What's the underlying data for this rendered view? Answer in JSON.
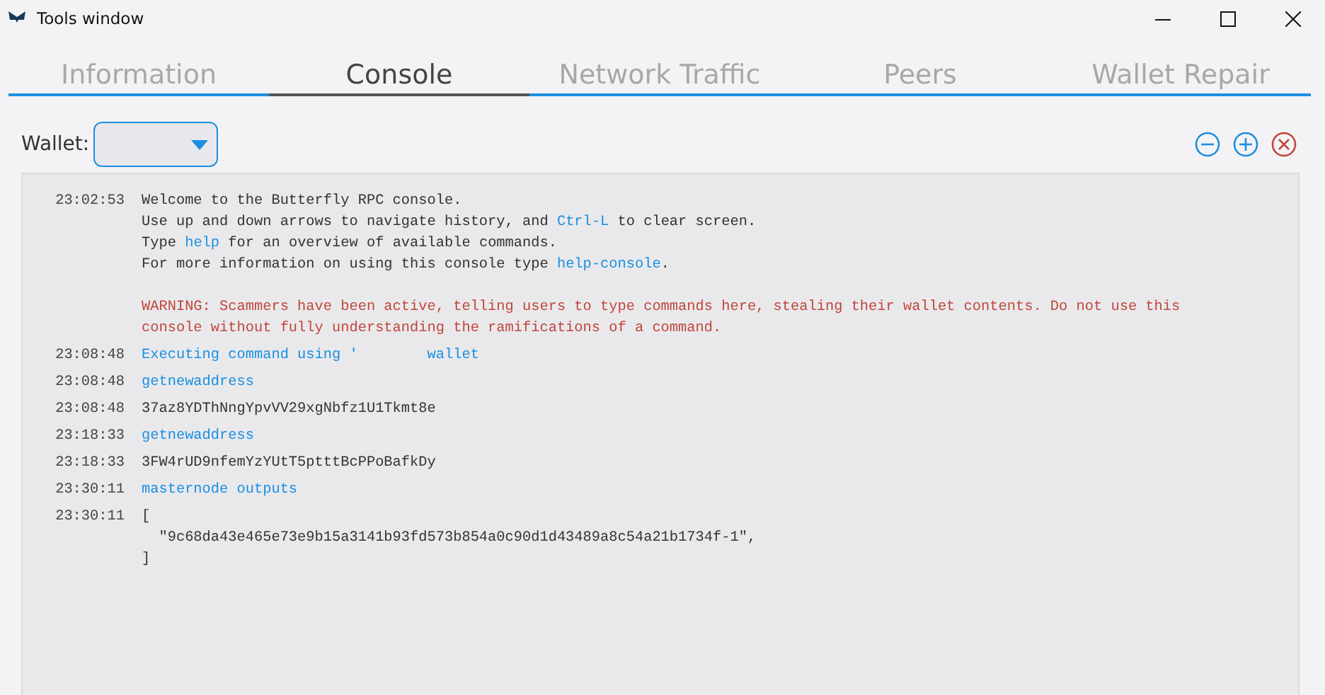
{
  "window": {
    "title": "Tools window"
  },
  "tabs": [
    {
      "label": "Information",
      "selected": false
    },
    {
      "label": "Console",
      "selected": true
    },
    {
      "label": "Network Traffic",
      "selected": false
    },
    {
      "label": "Peers",
      "selected": false
    },
    {
      "label": "Wallet Repair",
      "selected": false
    }
  ],
  "wallet": {
    "label": "Wallet:"
  },
  "console": [
    {
      "time": "23:02:53",
      "kind": "welcome",
      "lines": [
        [
          {
            "text": "Welcome to the Butterfly RPC console.",
            "kind": "plain"
          }
        ],
        [
          {
            "text": "Use up and down arrows to navigate history, and ",
            "kind": "plain"
          },
          {
            "text": "Ctrl-L",
            "kind": "command"
          },
          {
            "text": " to clear screen.",
            "kind": "plain"
          }
        ],
        [
          {
            "text": "Type ",
            "kind": "plain"
          },
          {
            "text": "help",
            "kind": "command"
          },
          {
            "text": " for an overview of available commands.",
            "kind": "plain"
          }
        ],
        [
          {
            "text": "For more information on using this console type ",
            "kind": "plain"
          },
          {
            "text": "help-console",
            "kind": "command"
          },
          {
            "text": ".",
            "kind": "plain"
          }
        ]
      ],
      "warning": "WARNING: Scammers have been active, telling users to type commands here, stealing their wallet contents. Do not use this console without fully understanding the ramifications of a command."
    },
    {
      "time": "23:08:48",
      "kind": "command",
      "lines": [
        "Executing command using '        wallet"
      ]
    },
    {
      "time": "23:08:48",
      "kind": "command",
      "lines": [
        "getnewaddress"
      ]
    },
    {
      "time": "23:08:48",
      "kind": "reply",
      "lines": [
        "37az8YDThNngYpvVV29xgNbfz1U1Tkmt8e"
      ]
    },
    {
      "time": "23:18:33",
      "kind": "command",
      "lines": [
        "getnewaddress"
      ]
    },
    {
      "time": "23:18:33",
      "kind": "reply",
      "lines": [
        "3FW4rUD9nfemYzYUtT5ptttBcPPoBafkDy"
      ]
    },
    {
      "time": "23:30:11",
      "kind": "command",
      "lines": [
        "masternode outputs"
      ]
    },
    {
      "time": "23:30:11",
      "kind": "reply",
      "lines": [
        "[",
        "  \"9c68da43e465e73e9b15a3141b93fd573b854a0c90d1d43489a8c54a21b1734f-1\",",
        "]"
      ]
    }
  ]
}
